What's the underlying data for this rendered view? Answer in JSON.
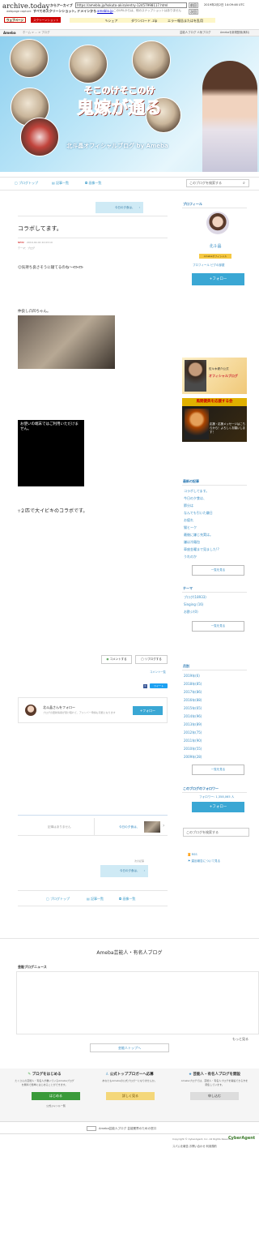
{
  "archive": {
    "logo": "archive.today",
    "sub": "webpage capture",
    "label": "からアーカイブ",
    "url": "https://ameblo.jp/hokuto-akira/entry-12457998117.html",
    "meta": "すべてのスクリーンショット, ドメインから",
    "domain": "ameblo.jp",
    "date": "2019年2月2日 14:09:46 UTC",
    "notice": "このURLからは、他のスナップショットはありません",
    "btn_left": "前回",
    "btn_right": "次回",
    "tab_web": "ウェブページ",
    "tab_shot": "スクリーンショット",
    "act_share": "シェア",
    "act_download": "ダウンロード .zip",
    "act_report": "エラー報告またはを乱用"
  },
  "ameba": {
    "logo": "Ameba",
    "crumb": "ホーム > ... > ブログ",
    "links": "芸能人ブログ  人気ブログ",
    "new": "Amebaを新規登録(無料)"
  },
  "banner": {
    "title_line1": "そこのけそこのけ",
    "title_line2": "鬼嫁が通る",
    "subtitle": "北斗晶オフィシャルブログ by Ameba"
  },
  "nav": {
    "top": "ブログトップ",
    "entries": "記事一覧",
    "images": "画像一覧",
    "search_placeholder": "このブログを検索する"
  },
  "post": {
    "prev_label": "今日の夕食は、",
    "title": "コラボしてます。",
    "new_badge": "NEW!",
    "date": "2019-02-02 22:03:10",
    "theme": "テーマ：ブログ",
    "line1": "☺気持ち良さそうに寝てるのね〜ᕙᕗᕙᕗ",
    "line2": "仲良し凸凹ちゃん。",
    "video_msg": "お使いの端末ではご利用いただけません。",
    "line3": "ｯ２匹で大イビキのコラボです。",
    "comment_btn": "コメントする",
    "reblog_btn": "リブログする",
    "comment_list": "コメント一覧",
    "count": "0",
    "follow_text": "北斗晶さんをフォロー",
    "follow_sub": "ブログの更新情報が受け取れて、アメンバー申請も可能になります",
    "follow_btn": "+フォロー"
  },
  "pager": {
    "prev": "記事はありません",
    "next": "今日の夕食は、",
    "label": "次の記事",
    "next_pill": "今日の夕食は、"
  },
  "sidebar": {
    "profile_head": "プロフィール",
    "name": "北斗晶",
    "official": "Amebaオフィシャル",
    "profile_links": "プロフィール  ピグの部屋",
    "follow": "+フォロー",
    "recent_head": "最新の記事",
    "recent": [
      "コラボしてます。",
      "今日の夕食は、",
      "節分は",
      "なんでも引いた嫌日",
      "お疲れ",
      "猫ヒーク",
      "最後に嫌じ充実は。",
      "嫌は冷麺包",
      "車座金曜まで見ました!?",
      "うれのか"
    ],
    "more": "一覧を見る",
    "theme_head": "テーマ",
    "themes": [
      "ブログ(18933)",
      "Singing (16)",
      "お酢ジ(0)"
    ],
    "archive_head": "月別",
    "archives": [
      "2019年(6)",
      "2018年(85)",
      "2017年(86)",
      "2016年(88)",
      "2015年(65)",
      "2014年(96)",
      "2013年(89)",
      "2012年(75)",
      "2011年(90)",
      "2010年(55)",
      "2009年(28)"
    ],
    "followers_head": "このブログのフォロワー",
    "followers": "フォロワー: 1,358,065 人",
    "search_placeholder": "このブログを検索する",
    "rss": "RSS",
    "report": "違反報告について見る"
  },
  "ads": {
    "ad1_title": "佐々木健介公式",
    "ad1_sub": "オフィシャルブログ",
    "ad2_title": "風間健典を応援する会",
    "ad2_sub": "応援・応援メッセージはこちらから！よろしくお願いします！"
  },
  "footer": {
    "section_title": "Ameba芸能人・有名人ブログ",
    "news_head": "芸能ブログニュース",
    "to_top": "芸能人トップへ",
    "more": "もっと見る",
    "col1_title": "ブログをはじめる",
    "col1_text": "たくさんの芸能人・有名人が書いているAmebaブログを無料で簡単にはじめることができます。",
    "col1_btn": "はじめる",
    "col1_link": "公式ジャンル一覧",
    "col2_title": "公式トップブロガーへ応募",
    "col2_text": "あなたもAmebaの公式ブロガーになりませんか。",
    "col2_btn": "詳しく見る",
    "col3_title": "芸能人・有名人ブログを開設",
    "col3_text": "Amebaブログでは、芸能人・有名人ブログを開設できる方を募集しています。",
    "col3_btn": "申し込む",
    "bottom_note": "Ameba芸能人ブログ 芸能業界のための窓口",
    "copyright": "Copyright © CyberAgent, Inc. All Rights Reserved.",
    "brand": "CyberAgent",
    "links": "スパムを報告  お問い合わせ  利用規約"
  }
}
